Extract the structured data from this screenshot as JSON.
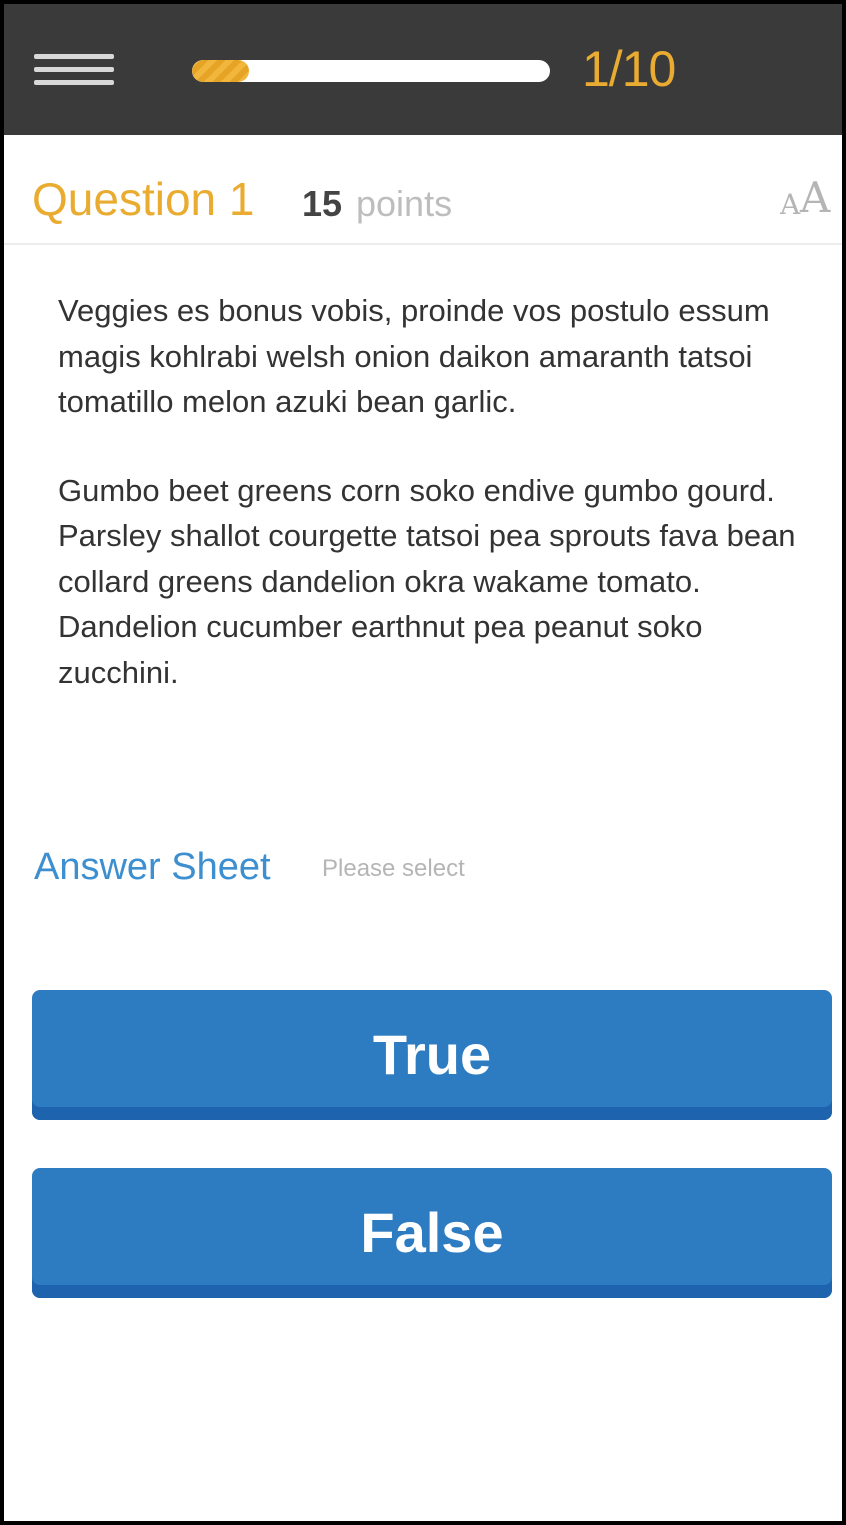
{
  "topbar": {
    "menu_icon": "hamburger-menu-icon",
    "progress_fraction": 0.1,
    "progress_counter": "1/10",
    "accent_color": "#e9ac31",
    "background_color": "#3a3a3a"
  },
  "question": {
    "title": "Question 1",
    "points_value": "15",
    "points_label": "points",
    "font_size_icon": "font-size-icon",
    "paragraph_1_line_1": "Veggies es bonus vobis, proinde vos postulo essum magis kohlrabi welsh onion daikon amaranth tatsoi",
    "paragraph_1_line_2": "tomatillo melon azuki bean garlic.",
    "paragraph_2": "Gumbo beet greens corn soko endive gumbo gourd. Parsley shallot courgette tatsoi pea sprouts fava bean collard greens dandelion okra wakame tomato. Dandelion cucumber earthnut pea peanut soko zucchini."
  },
  "answer_sheet": {
    "title": "Answer Sheet",
    "hint": "Please select",
    "options": [
      {
        "label": "True"
      },
      {
        "label": "False"
      }
    ],
    "button_color": "#2d7cc1"
  }
}
